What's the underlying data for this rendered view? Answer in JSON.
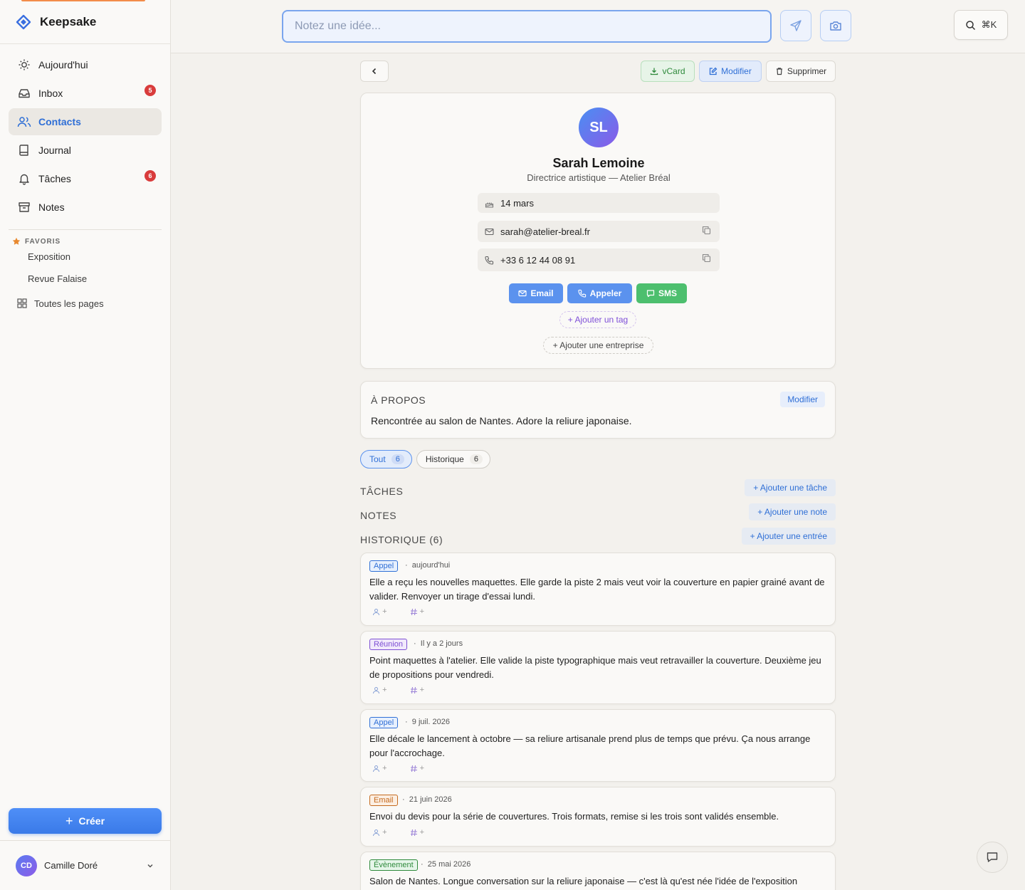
{
  "app": {
    "name": "Keepsake"
  },
  "sidebar": {
    "nav": [
      {
        "label": "Aujourd'hui",
        "icon": "sun-icon"
      },
      {
        "label": "Inbox",
        "icon": "inbox-icon",
        "badge": "5"
      },
      {
        "label": "Contacts",
        "icon": "users-icon",
        "active": true
      },
      {
        "label": "Journal",
        "icon": "book-icon"
      },
      {
        "label": "Tâches",
        "icon": "bell-icon",
        "badge": "6"
      },
      {
        "label": "Notes",
        "icon": "archive-icon"
      }
    ],
    "favorites_title": "FAVORIS",
    "favorites": [
      "Exposition",
      "Revue Falaise"
    ],
    "all_pages": "Toutes les pages",
    "create_label": "Créer",
    "user": {
      "initials": "CD",
      "name": "Camille Doré"
    }
  },
  "topbar": {
    "placeholder": "Notez une idée...",
    "shortcut": "⌘K"
  },
  "toolbar": {
    "vcard": "vCard",
    "edit": "Modifier",
    "delete": "Supprimer"
  },
  "contact": {
    "initials": "SL",
    "name": "Sarah Lemoine",
    "subtitle": "Directrice artistique — Atelier Bréal",
    "birthday": "14 mars",
    "email": "sarah@atelier-breal.fr",
    "phone": "+33 6 12 44 08 91",
    "actions": {
      "email": "Email",
      "call": "Appeler",
      "sms": "SMS"
    },
    "add_tag": "+ Ajouter un tag",
    "add_company": "+ Ajouter une entreprise"
  },
  "about": {
    "title": "À PROPOS",
    "edit": "Modifier",
    "text": "Rencontrée au salon de Nantes. Adore la reliure japonaise."
  },
  "tabs": [
    {
      "label": "Tout",
      "count": "6",
      "active": true
    },
    {
      "label": "Historique",
      "count": "6"
    }
  ],
  "sections": {
    "tasks": {
      "title": "TÂCHES",
      "add": "+ Ajouter une tâche"
    },
    "notes": {
      "title": "NOTES",
      "add": "+ Ajouter une note"
    },
    "history": {
      "title": "HISTORIQUE (6)",
      "add": "+ Ajouter une entrée"
    }
  },
  "history": [
    {
      "type": "Appel",
      "date": "aujourd'hui",
      "text": "Elle a reçu les nouvelles maquettes. Elle garde la piste 2 mais veut voir la couverture en papier grainé avant de valider. Renvoyer un tirage d'essai lundi."
    },
    {
      "type": "Réunion",
      "date": "Il y a 2 jours",
      "text": "Point maquettes à l'atelier. Elle valide la piste typographique mais veut retravailler la couverture. Deuxième jeu de propositions pour vendredi."
    },
    {
      "type": "Appel",
      "date": "9 juil. 2026",
      "text": "Elle décale le lancement à octobre — sa reliure artisanale prend plus de temps que prévu. Ça nous arrange pour l'accrochage."
    },
    {
      "type": "Email",
      "date": "21 juin 2026",
      "text": "Envoi du devis pour la série de couvertures. Trois formats, remise si les trois sont validés ensemble."
    },
    {
      "type": "Évènement",
      "date": "25 mai 2026",
      "text": "Salon de Nantes. Longue conversation sur la reliure japonaise — c'est là qu'est née l'idée de l'exposition"
    }
  ],
  "mini_actions": {
    "person": "+",
    "tag": "+"
  },
  "colors": {
    "accent": "#2f6fd6",
    "badge": "#d93c3c",
    "create": "#3a7ae8",
    "sms": "#4dbf6e"
  }
}
